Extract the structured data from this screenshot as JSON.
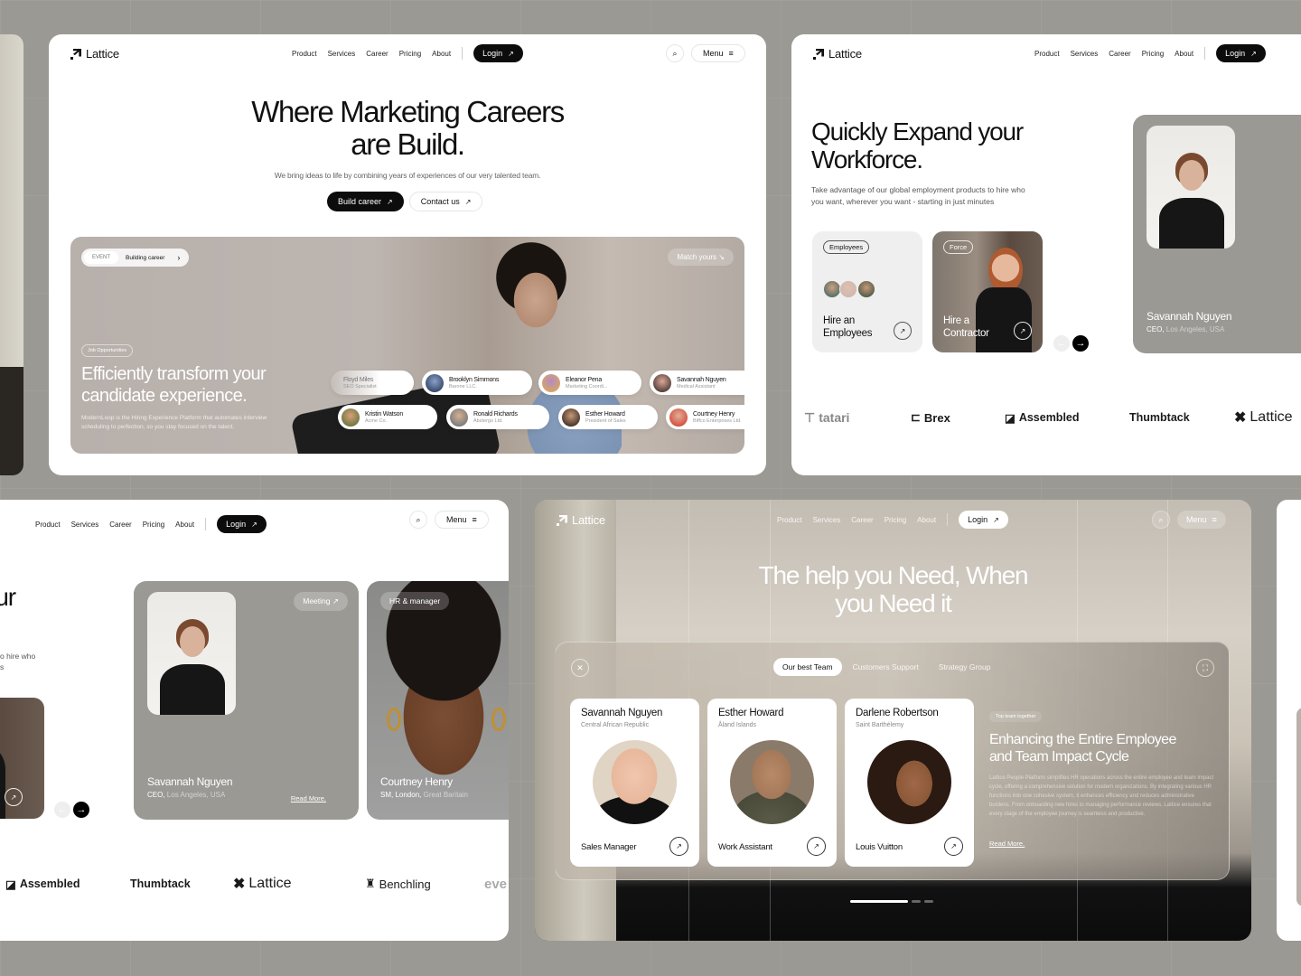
{
  "brand": "Lattice",
  "nav": {
    "items": [
      "Product",
      "Services",
      "Career",
      "Pricing",
      "About"
    ],
    "login": "Login",
    "menu": "Menu"
  },
  "panel1": {
    "title_line1": "Where Marketing Careers",
    "title_line2": "are Build.",
    "subtitle": "We bring ideas to life by combining years of experiences of our very talented team.",
    "cta_primary": "Build career",
    "cta_secondary": "Contact us",
    "banner": {
      "event_tag": "EVENT",
      "event_label": "Building career",
      "match_label": "Match yours",
      "chip": "Job Opportunities",
      "title_line1": "Efficiently transform your",
      "title_line2": "candidate experience.",
      "description": "ModernLoop is the Hiring Experience Platform that automates interview scheduling to perfection, so you stay focused on the talent.",
      "people_row1": [
        {
          "name": "Floyd Miles",
          "role": "SEO Specialist"
        },
        {
          "name": "Brooklyn Simmons",
          "role": "Barone LLC."
        },
        {
          "name": "Eleanor Pena",
          "role": "Marketing Coordi..."
        },
        {
          "name": "Savannah Nguyen",
          "role": "Medical Assistant"
        }
      ],
      "people_row2": [
        {
          "name": "Kristin Watson",
          "role": "Acme Co."
        },
        {
          "name": "Ronald Richards",
          "role": "Abstergo Ltd."
        },
        {
          "name": "Esther Howard",
          "role": "President of Sales"
        },
        {
          "name": "Courtney Henry",
          "role": "Biffco Enterprises Ltd."
        }
      ]
    }
  },
  "panel2": {
    "title_line1": "Quickly Expand your",
    "title_line2": "Workforce.",
    "subtitle_line1": "Take advantage of our global employment products to hire who",
    "subtitle_line2": "you want, wherever you want - starting in just minutes",
    "card1": {
      "tag": "Employees",
      "line1": "Hire an",
      "line2": "Employees"
    },
    "card2": {
      "tag": "Force",
      "line1": "Hire a",
      "line2": "Contractor"
    },
    "profile": {
      "name": "Savannah Nguyen",
      "role": "CEO,",
      "location": "Los Angeles, USA"
    },
    "logos": [
      "tatari",
      "Brex",
      "Assembled",
      "Thumbtack",
      "Lattice"
    ]
  },
  "panel3": {
    "title_fragment": "our",
    "subtitle_fragment1": "o hire who",
    "subtitle_fragment2": "s",
    "profile1": {
      "tag": "Meeting",
      "name": "Savannah Nguyen",
      "role": "CEO,",
      "location": "Los Angeles, USA",
      "link": "Read More."
    },
    "profile2": {
      "tag": "HR & manager",
      "name": "Courtney Henry",
      "role": "SM, London,",
      "location": "Great Baritain"
    },
    "logos": [
      "Assembled",
      "Thumbtack",
      "Lattice",
      "Benchling",
      "eve"
    ]
  },
  "panel4": {
    "title_line1": "The help you Need, When",
    "title_line2": "you Need it",
    "tabs": [
      "Our best Team",
      "Customers Support",
      "Strategy Group"
    ],
    "active_tab": 0,
    "team": [
      {
        "name": "Savannah Nguyen",
        "location": "Central African Republic",
        "job": "Sales Manager"
      },
      {
        "name": "Esther Howard",
        "location": "Åland Islands",
        "job": "Work Assistant"
      },
      {
        "name": "Darlene Robertson",
        "location": "Saint Barthélemy",
        "job": "Louis Vuitton"
      }
    ],
    "info": {
      "chip": "Top team together",
      "title_line1": "Enhancing the Entire Employee",
      "title_line2": "and Team Impact Cycle",
      "body": "Lattice People Platform simplifies HR operations across the entire employee and team impact cycle, offering a comprehensive solution for modern organizations. By integrating various HR functions into one cohesive system, it enhances efficiency and reduces administrative burdens. From onboarding new hires to managing performance reviews, Lattice ensures that every stage of the employee journey is seamless and productive.",
      "link": "Read More."
    },
    "carousel": {
      "total": 3,
      "active": 1
    }
  },
  "colors": {
    "background": "#9b9993",
    "accent_dark": "#0c0c0c",
    "card_gray": "#9a9994"
  }
}
